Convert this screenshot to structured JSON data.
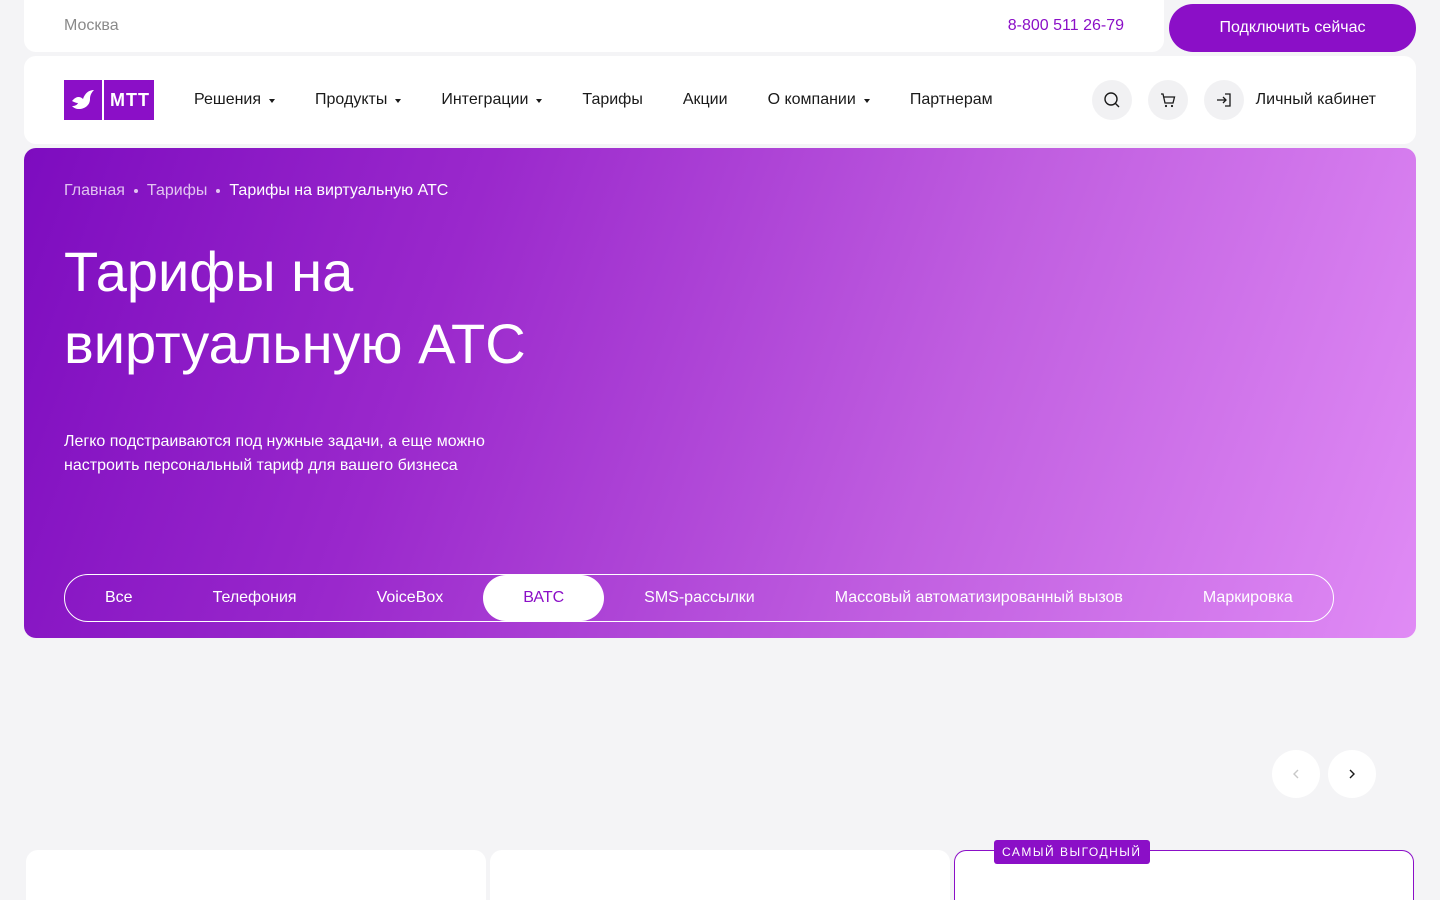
{
  "topbar": {
    "city": "Москва",
    "phone": "8-800 511 26-79",
    "connect_label": "Подключить сейчас"
  },
  "brand": {
    "logo_text": "МТТ",
    "color": "#8b0fc7"
  },
  "nav": {
    "items": [
      {
        "label": "Решения",
        "dropdown": true
      },
      {
        "label": "Продукты",
        "dropdown": true
      },
      {
        "label": "Интеграции",
        "dropdown": true
      },
      {
        "label": "Тарифы",
        "dropdown": false
      },
      {
        "label": "Акции",
        "dropdown": false
      },
      {
        "label": "О компании",
        "dropdown": true
      },
      {
        "label": "Партнерам",
        "dropdown": false
      }
    ],
    "icons": [
      "search-icon",
      "cart-icon",
      "login-icon"
    ],
    "cabinet_label": "Личный кабинет"
  },
  "hero": {
    "breadcrumb": [
      "Главная",
      "Тарифы",
      "Тарифы на виртуальную АТС"
    ],
    "title_line1": "Тарифы на",
    "title_line2": "виртуальную АТС",
    "desc_line1": "Легко подстраиваются под нужные задачи, а еще можно",
    "desc_line2": "настроить персональный тариф для вашего бизнеса",
    "tabs": [
      "Все",
      "Телефония",
      "VoiceBox",
      "ВАТС",
      "SMS-рассылки",
      "Массовый автоматизированный вызов",
      "Маркировка"
    ],
    "active_tab": "ВАТС"
  },
  "cards": {
    "badge": "САМЫЙ ВЫГОДНЫЙ"
  }
}
